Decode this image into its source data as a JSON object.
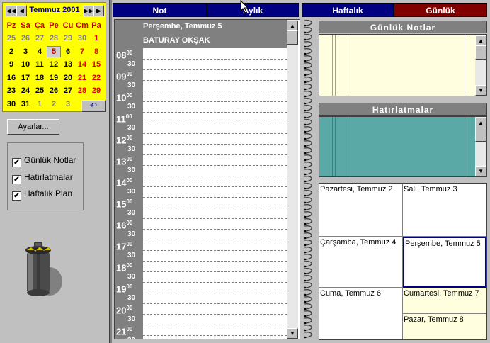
{
  "calendar": {
    "month_label": "Temmuz 2001",
    "weekday_headers": [
      "Pz",
      "Sa",
      "Ça",
      "Pe",
      "Cu",
      "Cm",
      "Pa"
    ],
    "weeks": [
      [
        "25",
        "26",
        "27",
        "28",
        "29",
        "30",
        "1"
      ],
      [
        "2",
        "3",
        "4",
        "5",
        "6",
        "7",
        "8"
      ],
      [
        "9",
        "10",
        "11",
        "12",
        "13",
        "14",
        "15"
      ],
      [
        "16",
        "17",
        "18",
        "19",
        "20",
        "21",
        "22"
      ],
      [
        "23",
        "24",
        "25",
        "26",
        "27",
        "28",
        "29"
      ],
      [
        "30",
        "31",
        "1",
        "2",
        "3"
      ]
    ],
    "selected_day": "5",
    "undo_icon": "↶"
  },
  "settings_button": "Ayarlar...",
  "options": [
    {
      "label": "Günlük Notlar",
      "checked": true
    },
    {
      "label": "Hatırlatmalar",
      "checked": true
    },
    {
      "label": "Haftalık Plan",
      "checked": true
    }
  ],
  "tabs": [
    {
      "label": "Not"
    },
    {
      "label": "Aylık"
    },
    {
      "label": "Haftalık"
    },
    {
      "label": "Günlük",
      "active": true
    }
  ],
  "day": {
    "date_title": "Perşembe, Temmuz 5",
    "owner": "BATURAY OKŞAK",
    "hours": [
      "08",
      "09",
      "10",
      "11",
      "12",
      "13",
      "14",
      "15",
      "16",
      "17",
      "18",
      "19",
      "20",
      "21"
    ],
    "minute_marker": "00",
    "half_label": "30"
  },
  "daily_notes_title": "Günlük Notlar",
  "reminders_title": "Hatırlatmalar",
  "week_days": [
    "Pazartesi, Temmuz 2",
    "Salı, Temmuz 3",
    "Çarşamba, Temmuz 4",
    "Perşembe, Temmuz 5",
    "Cuma, Temmuz 6",
    "Cumartesi, Temmuz 7",
    "Pazar, Temmuz 8"
  ],
  "colors": {
    "tab_bg": "#000080",
    "active_tab_bg": "#800000",
    "calendar_bg": "#ffff00",
    "notes_bg": "#ffffe0",
    "reminders_bg": "#5aa9a7"
  }
}
